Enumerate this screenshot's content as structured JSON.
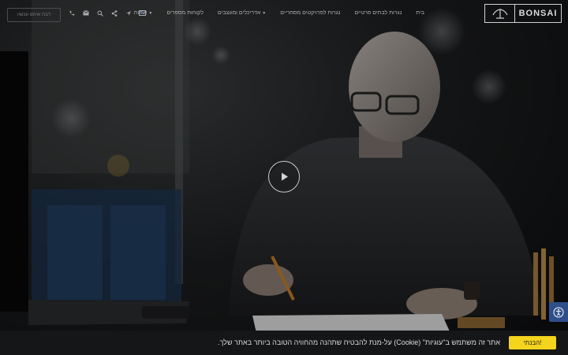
{
  "brand": {
    "name": "BONSAI"
  },
  "nav": {
    "items": [
      {
        "label": "בית",
        "caret": false
      },
      {
        "label": "נגרות לבתים פרטיים",
        "caret": false
      },
      {
        "label": "נגרות לפרויקטים מסחריים",
        "caret": false
      },
      {
        "label": "אדריכלים ומעצבים",
        "caret": true
      },
      {
        "label": "לקוחות מספרים",
        "caret": false
      },
      {
        "label": "אודות",
        "caret": true
      }
    ]
  },
  "tools": {
    "icons": [
      "flag-icon",
      "location-icon",
      "share-icon",
      "search-icon",
      "email-icon",
      "phone-icon"
    ]
  },
  "contact": {
    "phone_box": "דברו איתנו עכשיו"
  },
  "video": {
    "play_icon": "play-icon"
  },
  "accessibility": {
    "icon": "accessibility-icon",
    "color": "#2f4f8a"
  },
  "cookie": {
    "text": "אתר זה משתמש ב\"עוגיות\" (Cookie) על-מנת להבטיח שתהנה מהחוויה הטובה ביותר באתר שלך.",
    "button_label": "הבנתי!",
    "button_color": "#f5d41e"
  }
}
